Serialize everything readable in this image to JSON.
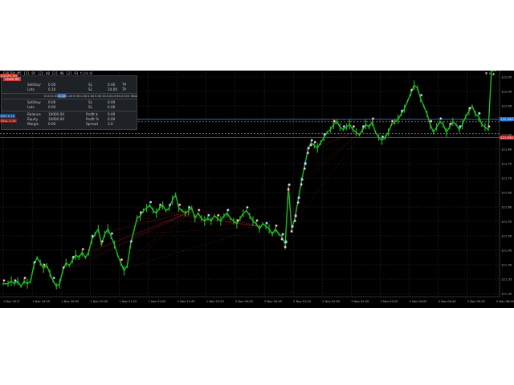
{
  "window": {
    "symbol_title": "EURJPY,M5  121.95 122.00 121.90 121.93  tick:0"
  },
  "panel": {
    "close_label": "Close All",
    "row1": {
      "a": "Sell/buy",
      "b": "0.00",
      "c": "SL",
      "d": "0.00",
      "e": "TP",
      "f": "0.00"
    },
    "row2": {
      "a": "Lots",
      "b": "0.10",
      "c": "SL",
      "d": "24.00",
      "e": "TP",
      "f": "36.00"
    },
    "tabs": [
      "0.01",
      "0.05",
      "0.10",
      "0.20",
      "0.50",
      "1.00",
      "2.00",
      "5.00",
      "10.0",
      "20.0",
      "50.0",
      "100",
      "Max"
    ],
    "tab_active_index": 2,
    "row3": {
      "a": "Sell/buy",
      "b": "0.00",
      "c": "SL",
      "d": "0.00",
      "e": "TP",
      "f": "0.00"
    },
    "row4": {
      "a": "Lots",
      "b": "0.00",
      "c": "SL",
      "d": "0.00",
      "e": "TP",
      "f": "0.00"
    },
    "row5": {
      "a": "Balance",
      "b": "10000.00",
      "c": "Profit $",
      "d": "0.00"
    },
    "row6": {
      "a": "Equity",
      "b": "10000.00",
      "c": "Profit %",
      "d": "0.00"
    },
    "row7": {
      "a": "Margin",
      "b": "0.00",
      "c": "Spread",
      "d": "3.0"
    }
  },
  "left_tags": [
    {
      "text": "EURJPY,M5",
      "color": "#c0392b"
    },
    {
      "text": "BUY 0.10",
      "color": "#1d4f91"
    },
    {
      "text": "SELL 0.10",
      "color": "#8b1a1a"
    }
  ],
  "price_tags": [
    {
      "text": "122.000",
      "color": "#1e6fd6"
    },
    {
      "text": "121.930",
      "color": "#d2312a"
    }
  ],
  "right_controls": "▼ × ▲",
  "price_axis_labels": [
    "122.05",
    "122.00",
    "121.95",
    "121.90",
    "121.85",
    "121.80",
    "121.75",
    "121.70",
    "121.65",
    "121.60",
    "121.55",
    "121.50",
    "121.45",
    "121.40",
    "121.35",
    "121.30"
  ],
  "time_axis_labels": [
    "1 Nov 2017",
    "1 Nov 19:25",
    "1 Nov 20:05",
    "1 Nov 20:45",
    "1 Nov 21:25",
    "1 Nov 22:05",
    "1 Nov 22:45",
    "1 Nov 23:25",
    "2 Nov 00:05",
    "2 Nov 00:45",
    "2 Nov 01:25",
    "2 Nov 02:05",
    "2 Nov 02:45",
    "2 Nov 03:25",
    "2 Nov 04:05",
    "2 Nov 04:45",
    "2 Nov 05:25",
    "2 Nov 06:05"
  ],
  "colors": {
    "background": "#000000",
    "grid": "#3b3b3b",
    "candle": "#1fbf1f",
    "marker_buy": "#5aa0ff",
    "marker_sell": "#ff5555",
    "marker_fill": "#e8d6ff",
    "trade_line": "#a32020",
    "blue_line": "#3d7fe0",
    "red_line": "#d23a3a"
  },
  "chart_data": {
    "type": "line",
    "title": "",
    "x": [
      0,
      6,
      10,
      14,
      18,
      22,
      26,
      30,
      34,
      38,
      42,
      46,
      50,
      54,
      58,
      62,
      66,
      70,
      74,
      78,
      82,
      86,
      90,
      94,
      98,
      102,
      106,
      110,
      114,
      118,
      122,
      126,
      130,
      134,
      138,
      142,
      146,
      150,
      154,
      158,
      162,
      166,
      170,
      174,
      178,
      182,
      186,
      190,
      194,
      198,
      202,
      206,
      210,
      214,
      218,
      222,
      226,
      230,
      234,
      238,
      242,
      246,
      250,
      254,
      258,
      262,
      266,
      270,
      274,
      278,
      282,
      286,
      290,
      294,
      298,
      302,
      306,
      310,
      314,
      318,
      322,
      326,
      330,
      334,
      338,
      342,
      346,
      350,
      354,
      358,
      362,
      366,
      370,
      374,
      378,
      382,
      386,
      390,
      394,
      398,
      402,
      406,
      410,
      414,
      418,
      422,
      426,
      430,
      434,
      438,
      442,
      446,
      450,
      454,
      458,
      462,
      466,
      470,
      474,
      478,
      482,
      486,
      490,
      494,
      498,
      502,
      506,
      510,
      514,
      518,
      522,
      526,
      530,
      534,
      538,
      542,
      546,
      550,
      554,
      558,
      562,
      566,
      570,
      574,
      578,
      582,
      586,
      590,
      594,
      598,
      602,
      606,
      612
    ],
    "y": [
      121.37,
      121.37,
      121.38,
      121.37,
      121.38,
      121.36,
      121.38,
      121.37,
      121.38,
      121.44,
      121.47,
      121.45,
      121.43,
      121.44,
      121.41,
      121.38,
      121.36,
      121.37,
      121.42,
      121.45,
      121.44,
      121.46,
      121.48,
      121.47,
      121.49,
      121.47,
      121.49,
      121.54,
      121.56,
      121.58,
      121.52,
      121.56,
      121.58,
      121.55,
      121.52,
      121.48,
      121.45,
      121.42,
      121.44,
      121.52,
      121.57,
      121.62,
      121.63,
      121.65,
      121.66,
      121.67,
      121.65,
      121.64,
      121.66,
      121.67,
      121.65,
      121.66,
      121.69,
      121.71,
      121.66,
      121.65,
      121.64,
      121.65,
      121.66,
      121.62,
      121.64,
      121.62,
      121.61,
      121.62,
      121.61,
      121.63,
      121.62,
      121.61,
      121.63,
      121.64,
      121.62,
      121.61,
      121.6,
      121.62,
      121.64,
      121.65,
      121.63,
      121.61,
      121.6,
      121.58,
      121.6,
      121.59,
      121.58,
      121.56,
      121.58,
      121.56,
      121.55,
      121.52,
      121.74,
      121.58,
      121.62,
      121.69,
      121.76,
      121.82,
      121.88,
      121.91,
      121.9,
      121.89,
      121.91,
      121.93,
      121.95,
      121.96,
      121.98,
      121.99,
      121.97,
      121.96,
      121.97,
      121.98,
      121.96,
      121.95,
      121.94,
      121.96,
      121.98,
      121.97,
      121.99,
      121.95,
      121.93,
      121.92,
      121.93,
      121.95,
      121.98,
      121.99,
      122.0,
      122.02,
      122.04,
      122.07,
      122.1,
      122.13,
      122.12,
      122.08,
      122.05,
      122.02,
      121.98,
      121.95,
      121.97,
      121.99,
      121.98,
      121.95,
      121.97,
      121.99,
      121.98,
      121.96,
      121.98,
      122.01,
      122.03,
      122.05,
      122.02,
      122.01,
      121.98,
      121.97,
      121.96
    ],
    "ylim": [
      121.32,
      122.18
    ],
    "horizontal_lines": [
      {
        "name": "blue",
        "y": 122.0
      },
      {
        "name": "red",
        "y": 121.93
      }
    ]
  }
}
